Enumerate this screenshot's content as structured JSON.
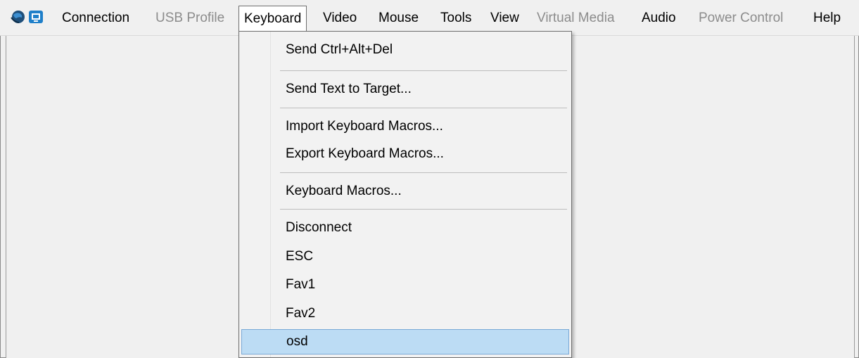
{
  "menubar": {
    "icons": [
      {
        "name": "globe-icon",
        "color": "#1f4f7a"
      },
      {
        "name": "remote-screen-icon",
        "color": "#1e7fc9"
      }
    ],
    "items": [
      {
        "label": "Connection",
        "enabled": true
      },
      {
        "label": "USB Profile",
        "enabled": false
      },
      {
        "label": "Keyboard",
        "enabled": true,
        "open": true
      },
      {
        "label": "Video",
        "enabled": true
      },
      {
        "label": "Mouse",
        "enabled": true
      },
      {
        "label": "Tools",
        "enabled": true
      },
      {
        "label": "View",
        "enabled": true
      },
      {
        "label": "Virtual Media",
        "enabled": false
      },
      {
        "label": "Audio",
        "enabled": true
      },
      {
        "label": "Power Control",
        "enabled": false
      },
      {
        "label": "Help",
        "enabled": true
      }
    ]
  },
  "keyboard_menu": {
    "items": [
      {
        "label": "Send Ctrl+Alt+Del"
      },
      {
        "label": "Send Text to Target..."
      },
      {
        "label": "Import Keyboard Macros..."
      },
      {
        "label": "Export Keyboard Macros..."
      },
      {
        "label": "Keyboard Macros..."
      },
      {
        "label": "Disconnect"
      },
      {
        "label": "ESC"
      },
      {
        "label": "Fav1"
      },
      {
        "label": "Fav2"
      },
      {
        "label": "osd",
        "highlighted": true
      }
    ]
  },
  "colors": {
    "highlight_bg": "#bcdcf4",
    "highlight_border": "#7aa9d6",
    "disabled_text": "#8c8c8c"
  }
}
